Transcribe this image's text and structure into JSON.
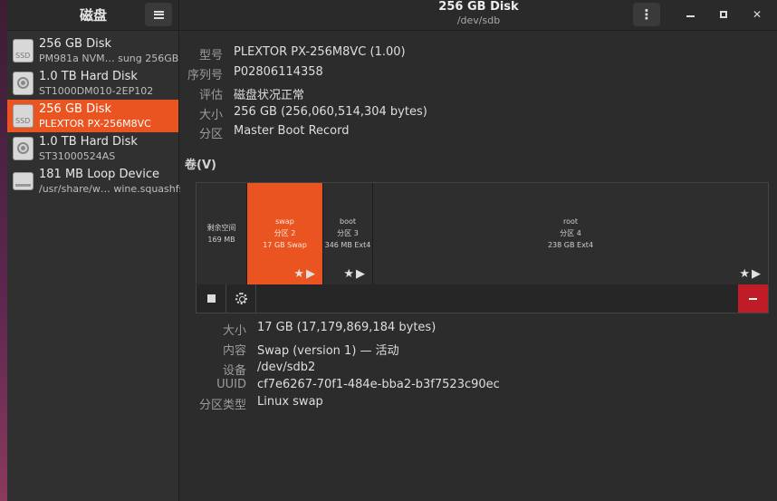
{
  "sidebar": {
    "title": "磁盘",
    "disks": [
      {
        "name": "256 GB Disk",
        "subtitle": "PM981a NVM… sung 256GB",
        "icon": "ssd-icon",
        "selected": false
      },
      {
        "name": "1.0 TB Hard Disk",
        "subtitle": "ST1000DM010-2EP102",
        "icon": "hdd-icon",
        "selected": false
      },
      {
        "name": "256 GB Disk",
        "subtitle": "PLEXTOR PX-256M8VC",
        "icon": "ssd-icon",
        "selected": true
      },
      {
        "name": "1.0 TB Hard Disk",
        "subtitle": "ST31000524AS",
        "icon": "hdd-icon",
        "selected": false
      },
      {
        "name": "181 MB Loop Device",
        "subtitle": "/usr/share/w… wine.squashfs",
        "icon": "loop-device-icon",
        "selected": false
      }
    ]
  },
  "header": {
    "title": "256 GB Disk",
    "subtitle": "/dev/sdb"
  },
  "disk_info": {
    "model_label": "型号",
    "model": "PLEXTOR PX-256M8VC (1.00)",
    "serial_label": "序列号",
    "serial": "P02806114358",
    "assessment_label": "评估",
    "assessment": "磁盘状况正常",
    "size_label": "大小",
    "size": "256 GB (256,060,514,304 bytes)",
    "partitioning_label": "分区",
    "partitioning": "Master Boot Record"
  },
  "volumes": {
    "label": "卷(V)",
    "segments": [
      {
        "key": "free",
        "line1": "剩余空间",
        "line2": "169 MB",
        "line3": "",
        "selected": false
      },
      {
        "key": "swap",
        "line1": "swap",
        "line2": "分区 2",
        "line3": "17 GB Swap",
        "selected": true
      },
      {
        "key": "boot",
        "line1": "boot",
        "line2": "分区 3",
        "line3": "346 MB Ext4",
        "selected": false
      },
      {
        "key": "root",
        "line1": "root",
        "line2": "分区 4",
        "line3": "238 GB Ext4",
        "selected": false
      }
    ]
  },
  "volume_info": {
    "size_label": "大小",
    "size": "17 GB (17,179,869,184 bytes)",
    "contents_label": "内容",
    "contents": "Swap (version 1) — 活动",
    "device_label": "设备",
    "device": "/dev/sdb2",
    "uuid_label": "UUID",
    "uuid": "cf7e6267-70f1-484e-bba2-b3f7523c90ec",
    "parttype_label": "分区类型",
    "parttype": "Linux swap"
  },
  "colors": {
    "accent": "#e95420",
    "danger": "#c01c28",
    "background": "#2c2c2c"
  }
}
